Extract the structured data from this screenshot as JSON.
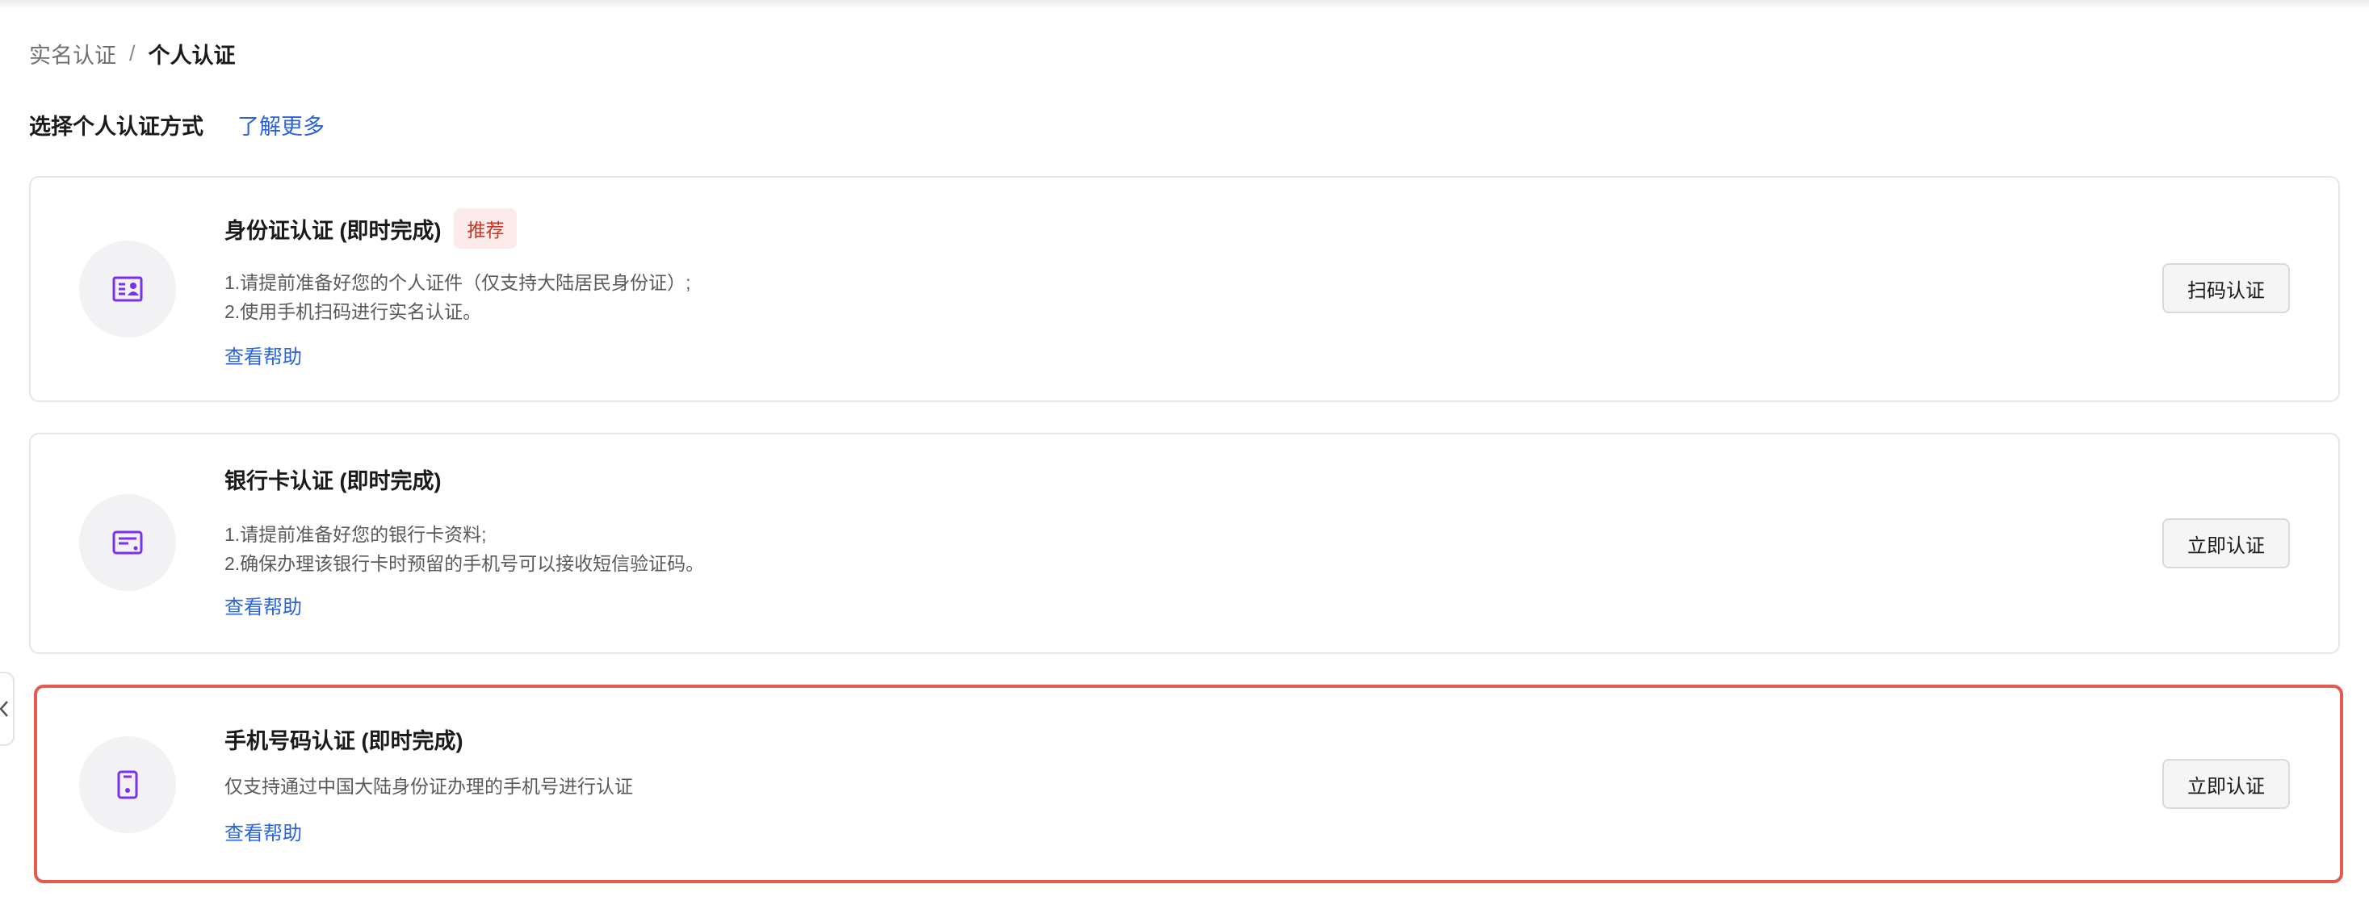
{
  "breadcrumb": {
    "parent": "实名认证",
    "separator": "/",
    "current": "个人认证"
  },
  "section": {
    "title": "选择个人认证方式",
    "learn_more": "了解更多"
  },
  "cards": [
    {
      "title": "身份证认证 (即时完成)",
      "badge": "推荐",
      "desc_lines": [
        "1.请提前准备好您的个人证件（仅支持大陆居民身份证）;",
        "2.使用手机扫码进行实名认证。"
      ],
      "help": "查看帮助",
      "button": "扫码认证",
      "icon": "id-card-icon"
    },
    {
      "title": "银行卡认证 (即时完成)",
      "desc_lines": [
        "1.请提前准备好您的银行卡资料;",
        "2.确保办理该银行卡时预留的手机号可以接收短信验证码。"
      ],
      "help": "查看帮助",
      "button": "立即认证",
      "icon": "bank-card-icon"
    },
    {
      "title": "手机号码认证 (即时完成)",
      "desc_lines": [
        "仅支持通过中国大陆身份证办理的手机号进行认证"
      ],
      "help": "查看帮助",
      "button": "立即认证",
      "icon": "mobile-phone-icon",
      "highlighted": true
    }
  ],
  "colors": {
    "link": "#2a63e0",
    "icon_accent": "#7b2ff0",
    "badge_bg": "#fdeaea",
    "badge_text": "#c0392b",
    "highlight_border": "#e25a50"
  }
}
